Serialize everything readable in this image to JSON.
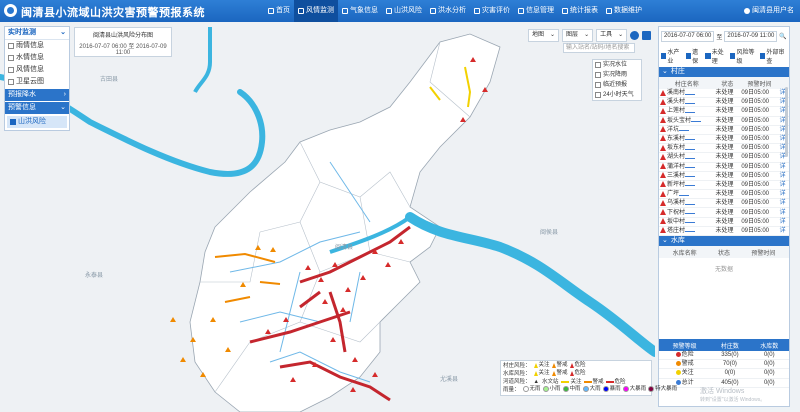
{
  "app": {
    "title": "闽清县小流域山洪灾害预警预报系统",
    "user": "闽清县用户名"
  },
  "nav": [
    {
      "label": "首页",
      "active": false
    },
    {
      "label": "风情监测",
      "active": true
    },
    {
      "label": "气象信息",
      "active": false
    },
    {
      "label": "山洪风险",
      "active": false
    },
    {
      "label": "洪水分析",
      "active": false
    },
    {
      "label": "灾害评价",
      "active": false
    },
    {
      "label": "信息管理",
      "active": false
    },
    {
      "label": "统计报表",
      "active": false
    },
    {
      "label": "数据维护",
      "active": false
    }
  ],
  "left_panel": {
    "header": "实时监测",
    "items": [
      {
        "label": "雨情信息",
        "checked": false
      },
      {
        "label": "水情信息",
        "checked": false
      },
      {
        "label": "风情信息",
        "checked": false
      },
      {
        "label": "卫星云图",
        "checked": false
      }
    ],
    "sections": [
      "预报降水",
      "预警信息"
    ],
    "selected": "山洪风险"
  },
  "info_box": {
    "title": "闽清县山洪风险分布图",
    "time_range": "2016-07-07 06:00 至 2016-07-09 11:00"
  },
  "map_tools": {
    "map": "地图",
    "layer": "图层",
    "tool": "工具",
    "search_placeholder": "输入站名/站码/地名搜索"
  },
  "layer_box": [
    "实况水位",
    "实况降雨",
    "临近预报",
    "24小时天气"
  ],
  "map_labels": [
    "永泰县",
    "古田县",
    "闽侯县",
    "尤溪县",
    "闽清县"
  ],
  "right_panel": {
    "date_from": "2016-07-07 06:00",
    "date_sep": "至",
    "date_to": "2016-07-09 11:00",
    "checks": [
      "水产业",
      "遗保",
      "未处理",
      "风险等级",
      "外部审查"
    ],
    "village_header": "村庄",
    "village_columns": [
      "村庄名称",
      "状态",
      "预警时间",
      ""
    ],
    "villages": [
      {
        "name": "溪南村",
        "status": "未处理",
        "time": "09日05:00",
        "act": "详"
      },
      {
        "name": "溪头村",
        "status": "未处理",
        "time": "09日05:00",
        "act": "详"
      },
      {
        "name": "上莲村",
        "status": "未处理",
        "time": "09日05:00",
        "act": "详"
      },
      {
        "name": "坂头宝村",
        "status": "未处理",
        "time": "09日05:00",
        "act": "详"
      },
      {
        "name": "洋坑",
        "status": "未处理",
        "time": "09日05:00",
        "act": "详"
      },
      {
        "name": "东溪村",
        "status": "未处理",
        "time": "09日05:00",
        "act": "详"
      },
      {
        "name": "坂东村",
        "status": "未处理",
        "time": "09日05:00",
        "act": "详"
      },
      {
        "name": "湖头村",
        "status": "未处理",
        "time": "09日05:00",
        "act": "详"
      },
      {
        "name": "蒲洋村",
        "status": "未处理",
        "time": "09日05:00",
        "act": "详"
      },
      {
        "name": "三溪村",
        "status": "未处理",
        "time": "09日05:00",
        "act": "详"
      },
      {
        "name": "新坪村",
        "status": "未处理",
        "time": "09日05:00",
        "act": "详"
      },
      {
        "name": "广坪",
        "status": "未处理",
        "time": "09日05:00",
        "act": "详"
      },
      {
        "name": "乌溪村",
        "status": "未处理",
        "time": "09日05:00",
        "act": "详"
      },
      {
        "name": "下祝村",
        "status": "未处理",
        "time": "09日05:00",
        "act": "详"
      },
      {
        "name": "坂中村",
        "status": "未处理",
        "time": "09日05:00",
        "act": "详"
      },
      {
        "name": "塔庄村",
        "status": "未处理",
        "time": "09日05:00",
        "act": "详"
      }
    ],
    "water_header": "水库",
    "water_columns": [
      "水库名称",
      "状态",
      "预警时间"
    ],
    "water_empty": "无数据",
    "stats_columns": [
      "预警等级",
      "村庄数",
      "水库数"
    ],
    "stats": [
      {
        "level": "危险",
        "color": "#d62b2b",
        "villages": "335(0)",
        "reservoirs": "0(0)"
      },
      {
        "level": "警戒",
        "color": "#f08a00",
        "villages": "70(0)",
        "reservoirs": "0(0)"
      },
      {
        "level": "关注",
        "color": "#f2d100",
        "villages": "0(0)",
        "reservoirs": "0(0)"
      },
      {
        "level": "总计",
        "color": "#3a7bd5",
        "villages": "405(0)",
        "reservoirs": "0(0)"
      }
    ]
  },
  "legend": {
    "row1_label": "村庄风险：",
    "row1_items": [
      {
        "label": "关注",
        "color": "#f2d100"
      },
      {
        "label": "警戒",
        "color": "#f08a00"
      },
      {
        "label": "危险",
        "color": "#d62b2b"
      }
    ],
    "row2_label": "水库风险：",
    "row2_items": [
      {
        "label": "关注",
        "color": "#f2d100"
      },
      {
        "label": "警戒",
        "color": "#f08a00"
      },
      {
        "label": "危险",
        "color": "#d62b2b"
      }
    ],
    "row3_label": "河道风险：",
    "row3_items": [
      {
        "label": "关注",
        "color": "#f2d100"
      },
      {
        "label": "警戒",
        "color": "#f08a00"
      },
      {
        "label": "危险",
        "color": "#d62b2b"
      }
    ],
    "row3_extra": "水文站",
    "row4_label": "雨量：",
    "row4_items": [
      {
        "label": "无雨",
        "color": "#ffffff"
      },
      {
        "label": "小雨",
        "color": "#a6f28f"
      },
      {
        "label": "中雨",
        "color": "#3dba3d"
      },
      {
        "label": "大雨",
        "color": "#61b8ff"
      },
      {
        "label": "暴雨",
        "color": "#0000fe"
      },
      {
        "label": "大暴雨",
        "color": "#fa00fa"
      },
      {
        "label": "特大暴雨",
        "color": "#800040"
      }
    ]
  },
  "watermark": {
    "line1": "激活 Windows",
    "line2": "转到\"设置\"以激活 Windows。"
  }
}
